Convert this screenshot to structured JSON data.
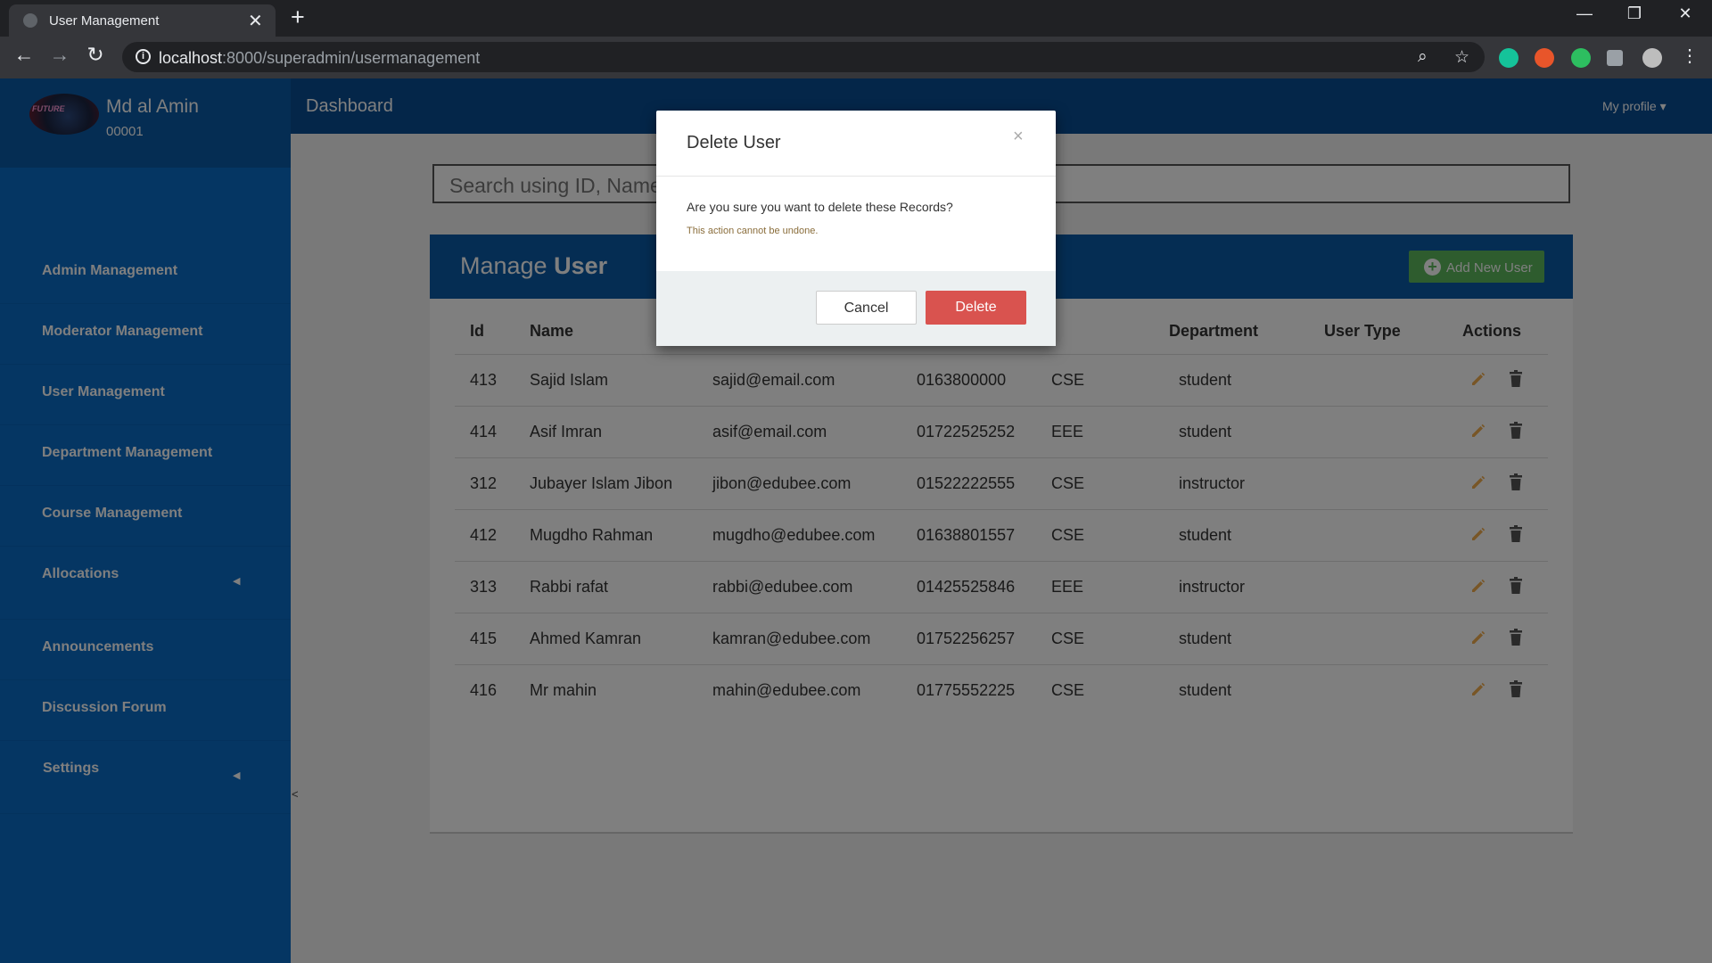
{
  "browser": {
    "tab_title": "User Management",
    "tab_close": "✕",
    "new_tab": "+",
    "url_host": "localhost",
    "url_rest": ":8000/superadmin/usermanagement",
    "info_glyph": "i",
    "back_glyph": "←",
    "forward_glyph": "→",
    "reload_glyph": "↻",
    "zoom_glyph": "⌕",
    "star_glyph": "☆",
    "menu_glyph": "⋮",
    "win_min": "—",
    "win_restore": "❐",
    "win_close": "✕"
  },
  "profile": {
    "name": "Md al Amin",
    "id": "00001",
    "avatar_text": "FUTURE"
  },
  "sidebar": {
    "items": [
      {
        "label": "Admin Management"
      },
      {
        "label": "Moderator Management"
      },
      {
        "label": "User Management"
      },
      {
        "label": "Department Management"
      },
      {
        "label": "Course Management"
      },
      {
        "label": "Allocations",
        "arrow": "◀"
      },
      {
        "label": "Announcements"
      },
      {
        "label": "Discussion Forum"
      },
      {
        "label": "Settings",
        "arrow": "◀"
      }
    ],
    "collapse": "<"
  },
  "topbar": {
    "title": "Dashboard",
    "profile_menu": "My profile ▾"
  },
  "search": {
    "placeholder": "Search using ID, Name"
  },
  "panel": {
    "title_light": "Manage ",
    "title_bold": "User",
    "add_button": "Add New User",
    "add_icon": "+"
  },
  "table": {
    "headers": {
      "id": "Id",
      "name": "Name",
      "department": "Department",
      "user_type": "User Type",
      "actions": "Actions"
    },
    "rows": [
      {
        "id": "413",
        "name": "Sajid Islam",
        "email": "sajid@email.com",
        "phone": "0163800000",
        "department": "CSE",
        "user_type": "student"
      },
      {
        "id": "414",
        "name": "Asif Imran",
        "email": "asif@email.com",
        "phone": "01722525252",
        "department": "EEE",
        "user_type": "student"
      },
      {
        "id": "312",
        "name": "Jubayer Islam Jibon",
        "email": "jibon@edubee.com",
        "phone": "01522222555",
        "department": "CSE",
        "user_type": "instructor"
      },
      {
        "id": "412",
        "name": "Mugdho Rahman",
        "email": "mugdho@edubee.com",
        "phone": "01638801557",
        "department": "CSE",
        "user_type": "student"
      },
      {
        "id": "313",
        "name": "Rabbi rafat",
        "email": "rabbi@edubee.com",
        "phone": "01425525846",
        "department": "EEE",
        "user_type": "instructor"
      },
      {
        "id": "415",
        "name": "Ahmed Kamran",
        "email": "kamran@edubee.com",
        "phone": "01752256257",
        "department": "CSE",
        "user_type": "student"
      },
      {
        "id": "416",
        "name": "Mr mahin",
        "email": "mahin@edubee.com",
        "phone": "01775552225",
        "department": "CSE",
        "user_type": "student"
      }
    ]
  },
  "modal": {
    "title": "Delete User",
    "close": "×",
    "question": "Are you sure you want to delete these Records?",
    "warning": "This action cannot be undone.",
    "cancel": "Cancel",
    "delete": "Delete"
  },
  "colors": {
    "sidebar": "#0a6cc7",
    "topbar": "#094d93",
    "add_button": "#5cb85c",
    "delete_button": "#d9534f",
    "edit_icon": "#f0ad4e"
  }
}
